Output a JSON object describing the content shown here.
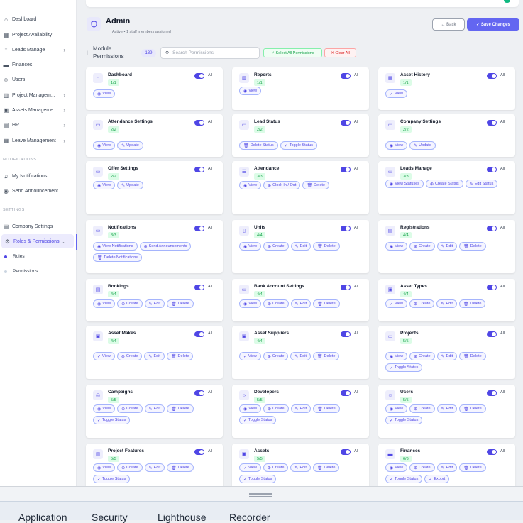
{
  "sidebar": {
    "items": [
      {
        "label": "Dashboard",
        "icon": "home-icon",
        "chev": false,
        "name": "sidebar-item-dashboard"
      },
      {
        "label": "Project Availability",
        "icon": "grid-icon",
        "chev": false,
        "name": "sidebar-item-project-availability"
      },
      {
        "label": "Leads Manage",
        "icon": "user-plus-icon",
        "chev": true,
        "name": "sidebar-item-leads-manage"
      },
      {
        "label": "Finances",
        "icon": "credit-card-icon",
        "chev": false,
        "name": "sidebar-item-finances"
      },
      {
        "label": "Users",
        "icon": "user-icon",
        "chev": false,
        "name": "sidebar-item-users"
      },
      {
        "label": "Project Managem...",
        "icon": "building-icon",
        "chev": true,
        "name": "sidebar-item-project-management"
      },
      {
        "label": "Assets Manageme...",
        "icon": "box-icon",
        "chev": true,
        "name": "sidebar-item-assets-management"
      },
      {
        "label": "HR",
        "icon": "briefcase-icon",
        "chev": true,
        "name": "sidebar-item-hr"
      },
      {
        "label": "Leave Management",
        "icon": "calendar-icon",
        "chev": true,
        "name": "sidebar-item-leave-management"
      }
    ],
    "notifications_header": "NOTIFICATIONS",
    "notif_items": [
      {
        "label": "My Notifications",
        "icon": "bell-icon",
        "name": "sidebar-item-my-notifications"
      },
      {
        "label": "Send Announcement",
        "icon": "broadcast-icon",
        "name": "sidebar-item-send-announcement"
      }
    ],
    "settings_header": "SETTINGS",
    "settings_items": [
      {
        "label": "Company Settings",
        "icon": "document-icon",
        "chev": false,
        "active": false,
        "name": "sidebar-item-company-settings"
      },
      {
        "label": "Roles & Permissions",
        "icon": "gear-icon",
        "chev": true,
        "active": true,
        "name": "sidebar-item-roles-permissions"
      }
    ],
    "sub_items": [
      {
        "label": "Roles",
        "active": true
      },
      {
        "label": "Permissions",
        "active": false
      }
    ]
  },
  "header": {
    "title": "Admin",
    "subtitle": "Active  •  1 staff members assigned",
    "back_label": "← Back",
    "save_label": "✓ Save Changes"
  },
  "toolbar": {
    "module_label": "Module Permissions",
    "count": "139",
    "search_placeholder": "Search Permissions",
    "select_all_label": "✓ Select All Permissions",
    "clear_all_label": "✕ Clear All"
  },
  "all_label": "All",
  "modules": [
    {
      "title": "Dashboard",
      "badge": "1/1",
      "icon": "home-icon",
      "glyph": "⌂",
      "perms": [
        {
          "label": "View",
          "icon": "eye"
        }
      ]
    },
    {
      "title": "Reports",
      "badge": "1/1",
      "icon": "chart-icon",
      "glyph": "▥",
      "perms": [
        {
          "label": "View",
          "icon": "eye"
        }
      ]
    },
    {
      "title": "Asset History",
      "badge": "1/1",
      "icon": "calendar-icon",
      "glyph": "▦",
      "perms": [
        {
          "label": "View",
          "icon": "check"
        }
      ]
    },
    {
      "title": "Attendance Settings",
      "badge": "2/2",
      "icon": "folder-icon",
      "glyph": "▭",
      "perms": [
        {
          "label": "View",
          "icon": "eye"
        },
        {
          "label": "Update",
          "icon": "edit"
        }
      ]
    },
    {
      "title": "Lead Status",
      "badge": "2/2",
      "icon": "folder-icon",
      "glyph": "▭",
      "perms": [
        {
          "label": "Delete Status",
          "icon": "trash"
        },
        {
          "label": "Toggle Status",
          "icon": "check"
        }
      ]
    },
    {
      "title": "Company Settings",
      "badge": "2/2",
      "icon": "folder-icon",
      "glyph": "▭",
      "perms": [
        {
          "label": "View",
          "icon": "eye"
        },
        {
          "label": "Update",
          "icon": "edit"
        }
      ]
    },
    {
      "title": "Offer Settings",
      "badge": "2/2",
      "icon": "folder-icon",
      "glyph": "▭",
      "perms": [
        {
          "label": "View",
          "icon": "eye"
        },
        {
          "label": "Update",
          "icon": "edit"
        }
      ]
    },
    {
      "title": "Attendance",
      "badge": "3/3",
      "icon": "list-icon",
      "glyph": "☰",
      "perms": [
        {
          "label": "View",
          "icon": "eye"
        },
        {
          "label": "Clock In / Out",
          "icon": "plus"
        },
        {
          "label": "Delete",
          "icon": "trash"
        }
      ]
    },
    {
      "title": "Leads Manage",
      "badge": "3/3",
      "icon": "folder-icon",
      "glyph": "▭",
      "perms": [
        {
          "label": "View Statuses",
          "icon": "eye"
        },
        {
          "label": "Create Status",
          "icon": "plus"
        },
        {
          "label": "Edit Status",
          "icon": "edit"
        }
      ]
    },
    {
      "title": "Notifications",
      "badge": "3/3",
      "icon": "folder-icon",
      "glyph": "▭",
      "perms": [
        {
          "label": "View Notifications",
          "icon": "eye"
        },
        {
          "label": "Send Announcements",
          "icon": "plus"
        },
        {
          "label": "Delete Notifications",
          "icon": "trash"
        }
      ]
    },
    {
      "title": "Units",
      "badge": "4/4",
      "icon": "door-icon",
      "glyph": "▯",
      "perms": [
        {
          "label": "View",
          "icon": "eye"
        },
        {
          "label": "Create",
          "icon": "plus"
        },
        {
          "label": "Edit",
          "icon": "edit"
        },
        {
          "label": "Delete",
          "icon": "trash"
        }
      ]
    },
    {
      "title": "Registrations",
      "badge": "4/4",
      "icon": "document-icon",
      "glyph": "▤",
      "perms": [
        {
          "label": "View",
          "icon": "eye"
        },
        {
          "label": "Create",
          "icon": "plus"
        },
        {
          "label": "Edit",
          "icon": "edit"
        },
        {
          "label": "Delete",
          "icon": "trash"
        }
      ]
    },
    {
      "title": "Bookings",
      "badge": "4/4",
      "icon": "document-icon",
      "glyph": "▤",
      "perms": [
        {
          "label": "View",
          "icon": "eye"
        },
        {
          "label": "Create",
          "icon": "plus"
        },
        {
          "label": "Edit",
          "icon": "edit"
        },
        {
          "label": "Delete",
          "icon": "trash"
        }
      ]
    },
    {
      "title": "Bank Account Settings",
      "badge": "4/4",
      "icon": "folder-icon",
      "glyph": "▭",
      "perms": [
        {
          "label": "View",
          "icon": "eye"
        },
        {
          "label": "Create",
          "icon": "plus"
        },
        {
          "label": "Edit",
          "icon": "edit"
        },
        {
          "label": "Delete",
          "icon": "trash"
        }
      ]
    },
    {
      "title": "Asset Types",
      "badge": "4/4",
      "icon": "box-icon",
      "glyph": "▣",
      "perms": [
        {
          "label": "View",
          "icon": "check"
        },
        {
          "label": "Create",
          "icon": "plus"
        },
        {
          "label": "Edit",
          "icon": "edit"
        },
        {
          "label": "Delete",
          "icon": "trash"
        }
      ]
    },
    {
      "title": "Asset Makes",
      "badge": "4/4",
      "icon": "box-icon",
      "glyph": "▣",
      "perms": [
        {
          "label": "View",
          "icon": "check"
        },
        {
          "label": "Create",
          "icon": "plus"
        },
        {
          "label": "Edit",
          "icon": "edit"
        },
        {
          "label": "Delete",
          "icon": "trash"
        }
      ]
    },
    {
      "title": "Asset Suppliers",
      "badge": "4/4",
      "icon": "box-icon",
      "glyph": "▣",
      "perms": [
        {
          "label": "View",
          "icon": "check"
        },
        {
          "label": "Create",
          "icon": "plus"
        },
        {
          "label": "Edit",
          "icon": "edit"
        },
        {
          "label": "Delete",
          "icon": "trash"
        }
      ]
    },
    {
      "title": "Projects",
      "badge": "5/5",
      "icon": "folder-icon",
      "glyph": "▭",
      "perms": [
        {
          "label": "View",
          "icon": "eye"
        },
        {
          "label": "Create",
          "icon": "plus"
        },
        {
          "label": "Edit",
          "icon": "edit"
        },
        {
          "label": "Delete",
          "icon": "trash"
        },
        {
          "label": "Toggle Status",
          "icon": "check"
        }
      ]
    },
    {
      "title": "Campaigns",
      "badge": "5/5",
      "icon": "target-icon",
      "glyph": "◎",
      "perms": [
        {
          "label": "View",
          "icon": "eye"
        },
        {
          "label": "Create",
          "icon": "plus"
        },
        {
          "label": "Edit",
          "icon": "edit"
        },
        {
          "label": "Delete",
          "icon": "trash"
        },
        {
          "label": "Toggle Status",
          "icon": "check"
        }
      ]
    },
    {
      "title": "Developers",
      "badge": "5/5",
      "icon": "code-icon",
      "glyph": "‹›",
      "perms": [
        {
          "label": "View",
          "icon": "eye"
        },
        {
          "label": "Create",
          "icon": "plus"
        },
        {
          "label": "Edit",
          "icon": "edit"
        },
        {
          "label": "Delete",
          "icon": "trash"
        },
        {
          "label": "Toggle Status",
          "icon": "check"
        }
      ]
    },
    {
      "title": "Users",
      "badge": "5/5",
      "icon": "user-icon",
      "glyph": "☺",
      "perms": [
        {
          "label": "View",
          "icon": "eye"
        },
        {
          "label": "Create",
          "icon": "plus"
        },
        {
          "label": "Edit",
          "icon": "edit"
        },
        {
          "label": "Delete",
          "icon": "trash"
        },
        {
          "label": "Toggle Status",
          "icon": "check"
        }
      ]
    },
    {
      "title": "Project Features",
      "badge": "5/5",
      "icon": "building-icon",
      "glyph": "▥",
      "perms": [
        {
          "label": "View",
          "icon": "eye"
        },
        {
          "label": "Create",
          "icon": "plus"
        },
        {
          "label": "Edit",
          "icon": "edit"
        },
        {
          "label": "Delete",
          "icon": "trash"
        },
        {
          "label": "Toggle Status",
          "icon": "check"
        }
      ]
    },
    {
      "title": "Assets",
      "badge": "5/5",
      "icon": "box-icon",
      "glyph": "▣",
      "perms": [
        {
          "label": "View",
          "icon": "check"
        },
        {
          "label": "Create",
          "icon": "plus"
        },
        {
          "label": "Edit",
          "icon": "edit"
        },
        {
          "label": "Delete",
          "icon": "trash"
        },
        {
          "label": "Toggle Status",
          "icon": "check"
        }
      ]
    },
    {
      "title": "Finances",
      "badge": "6/6",
      "icon": "credit-card-icon",
      "glyph": "▬",
      "perms": [
        {
          "label": "View",
          "icon": "eye"
        },
        {
          "label": "Create",
          "icon": "plus"
        },
        {
          "label": "Edit",
          "icon": "edit"
        },
        {
          "label": "Delete",
          "icon": "trash"
        },
        {
          "label": "Toggle Status",
          "icon": "check"
        },
        {
          "label": "Export",
          "icon": "check"
        }
      ]
    }
  ],
  "devtools_tabs": [
    "Application",
    "Security",
    "Lighthouse",
    "Recorder"
  ],
  "colors": {
    "accent": "#6366f1",
    "success": "#16a34a",
    "danger": "#dc2626"
  }
}
